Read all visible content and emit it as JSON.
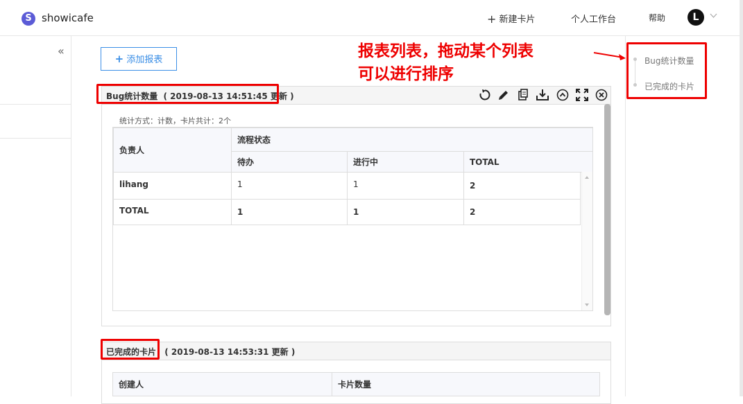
{
  "app": {
    "logo_letter": "S",
    "name": "showicafe"
  },
  "nav": {
    "new_card": "新建卡片",
    "workspace": "个人工作台",
    "help": "帮助",
    "avatar_letter": "L"
  },
  "sidebar": {
    "collapse_glyph": "«"
  },
  "toolbar": {
    "add_report": "添加报表"
  },
  "annotation": {
    "line1": "报表列表，拖动某个列表",
    "line2": "可以进行排序",
    "color": "#e00000"
  },
  "report_list": [
    {
      "label": "Bug统计数量"
    },
    {
      "label": "已完成的卡片"
    }
  ],
  "reports": [
    {
      "title": "Bug统计数量",
      "updated": "( 2019-08-13 14:51:45 更新 )",
      "summary": "统计方式：计数，卡片共计：2个",
      "row_header": "负责人",
      "group_header": "流程状态",
      "columns": [
        "待办",
        "进行中",
        "TOTAL"
      ],
      "rows": [
        {
          "label": "lihang",
          "values": [
            "1",
            "1",
            "2"
          ]
        },
        {
          "label": "TOTAL",
          "values": [
            "1",
            "1",
            "2"
          ]
        }
      ]
    },
    {
      "title": "已完成的卡片",
      "updated": "( 2019-08-13 14:53:31 更新 )",
      "columns": [
        "创建人",
        "卡片数量"
      ]
    }
  ],
  "colors": {
    "accent": "#3a8ee6",
    "link": "#2e7ed6",
    "brand": "#5b5bd6"
  }
}
